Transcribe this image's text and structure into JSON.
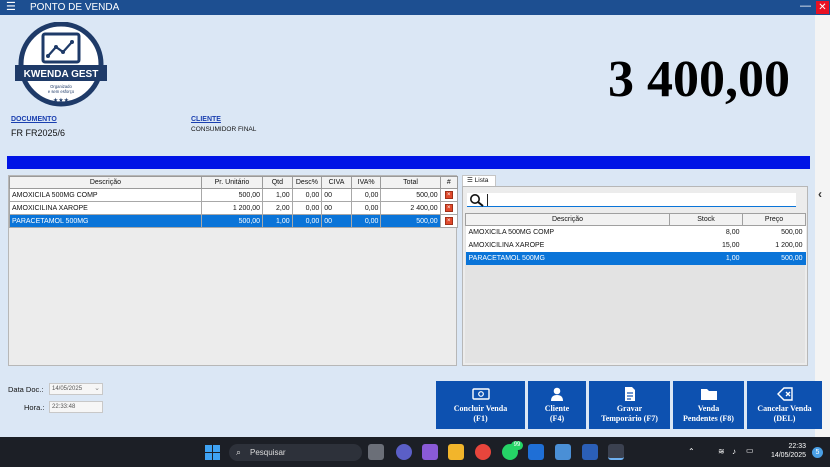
{
  "window": {
    "title": "PONTO DE VENDA",
    "minimize": "—",
    "close": "✕"
  },
  "logo": {
    "text": "KWENDA GEST",
    "tagline_1": "Organizado",
    "tagline_2": "e sem esforço",
    "stars": "★★★"
  },
  "total": "3 400,00",
  "documento": {
    "label": "DOCUMENTO",
    "value": "FR FR2025/6"
  },
  "cliente": {
    "label": "CLIENTE",
    "value": "CONSUMIDOR FINAL"
  },
  "sales": {
    "headers": [
      "Descrição",
      "Pr. Unitário",
      "Qtd",
      "Desc%",
      "CIVA",
      "IVA%",
      "Total",
      "#"
    ],
    "rows": [
      [
        "AMOXICILA 500MG COMP",
        "500,00",
        "1,00",
        "0,00",
        "00",
        "0,00",
        "500,00"
      ],
      [
        "AMOXICILINA XAROPE",
        "1 200,00",
        "2,00",
        "0,00",
        "00",
        "0,00",
        "2 400,00"
      ],
      [
        "PARACETAMOL 500MG",
        "500,00",
        "1,00",
        "0,00",
        "00",
        "0,00",
        "500,00"
      ]
    ],
    "delete_icon": "×"
  },
  "lista": {
    "tab_label": "Lista",
    "search_value": "",
    "headers": [
      "Descrição",
      "Stock",
      "Preço"
    ],
    "rows": [
      [
        "AMOXICILA 500MG COMP",
        "8,00",
        "500,00"
      ],
      [
        "AMOXICILINA XAROPE",
        "15,00",
        "1 200,00"
      ],
      [
        "PARACETAMOL 500MG",
        "1,00",
        "500,00"
      ]
    ]
  },
  "date_doc": {
    "label": "Data Doc.:",
    "value": "14/05/2025",
    "dropdown": "⌄"
  },
  "hora": {
    "label": "Hora.:",
    "value": "22:33:48"
  },
  "buttons": {
    "concluir": [
      "Concluir Venda",
      "(F1)"
    ],
    "cliente": [
      "Cliente",
      "(F4)"
    ],
    "gravar": [
      "Gravar",
      "Temporário (F7)"
    ],
    "pendentes": [
      "Venda",
      "Pendentes (F8)"
    ],
    "cancelar": [
      "Cancelar Venda",
      "(DEL)"
    ]
  },
  "right_strip": {
    "chevron": "‹"
  },
  "taskbar": {
    "search_placeholder": "Pesquisar",
    "whatsapp_badge": "99",
    "time": "22:33",
    "date": "14/05/2025",
    "notifications": "5"
  },
  "colors": {
    "title_bar": "#1d4f91",
    "accent_bar": "#0014e6",
    "selection": "#0a74d8",
    "button": "#0d51b0",
    "logo_navy": "#1e3a68"
  }
}
